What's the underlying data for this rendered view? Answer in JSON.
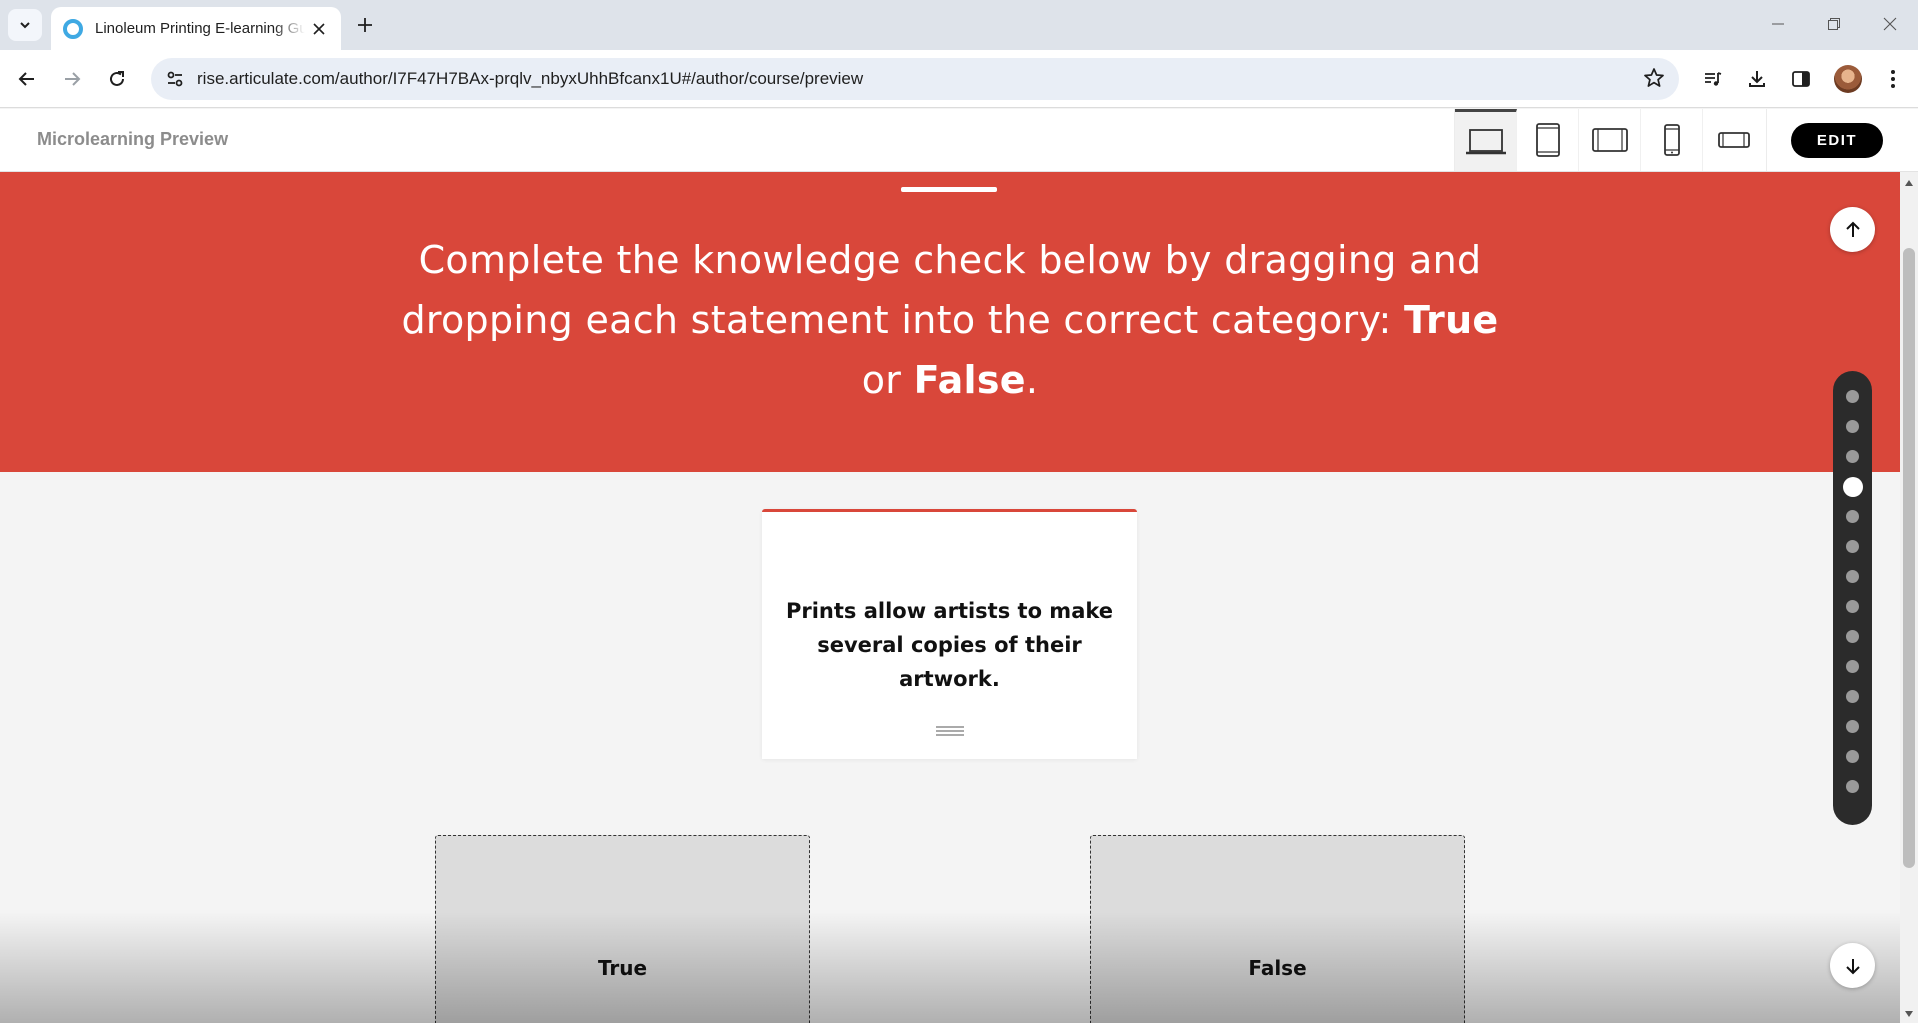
{
  "browser": {
    "tab_title": "Linoleum Printing E-learning Gu",
    "url": "rise.articulate.com/author/I7F47H7BAx-prqlv_nbyxUhhBfcanx1U#/author/course/preview"
  },
  "app": {
    "title": "Microlearning Preview",
    "edit_label": "EDIT",
    "devices": [
      "laptop-icon",
      "tablet-portrait-icon",
      "tablet-landscape-icon",
      "phone-portrait-icon",
      "phone-landscape-icon"
    ],
    "active_device": "laptop"
  },
  "banner": {
    "line1": "Complete the knowledge check below by dragging and",
    "line2_pre": "dropping each statement into the correct category: ",
    "true_word": "True",
    "line3_pre": "or ",
    "false_word": "False",
    "line3_post": "."
  },
  "card": {
    "statement": "Prints allow artists to make several copies of their artwork."
  },
  "categories": [
    {
      "label": "True"
    },
    {
      "label": "False"
    }
  ],
  "progress": {
    "total_sections": 14,
    "current_section": 4
  },
  "colors": {
    "accent": "#d9473a",
    "button": "#000000"
  }
}
